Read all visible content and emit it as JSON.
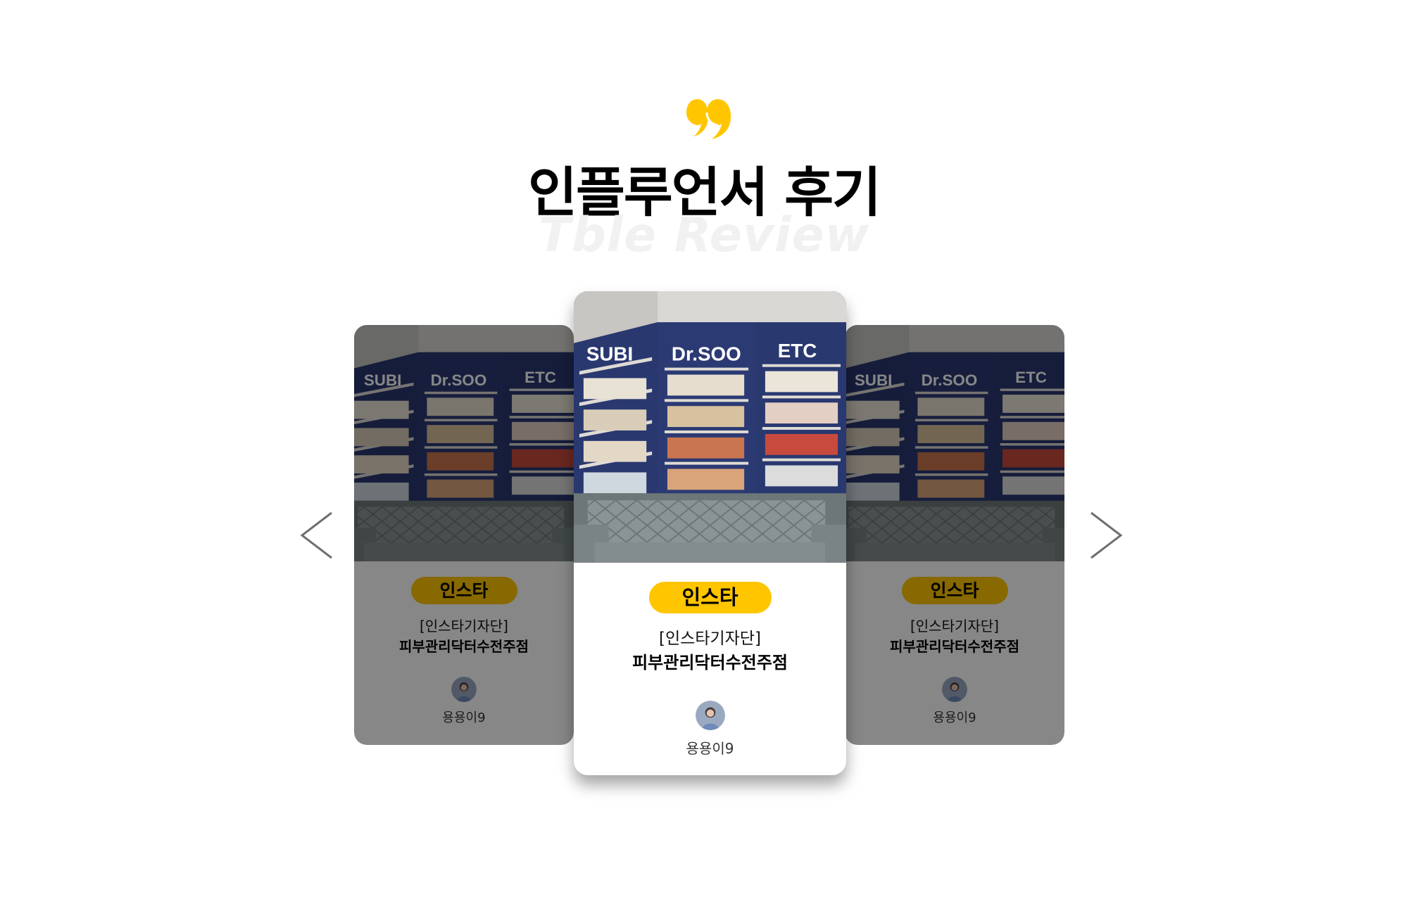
{
  "header": {
    "title": "인플루언서 후기",
    "subtitle": "Tble Review",
    "quote_icon": "quote-icon",
    "accent_color": "#ffc600"
  },
  "carousel": {
    "prev_icon": "chevron-left-icon",
    "next_icon": "chevron-right-icon",
    "cards": [
      {
        "position": "left",
        "state": "inactive",
        "badge": "인스타",
        "tag": "[인스타기자단]",
        "store": "피부관리닥터수전주점",
        "user": "용용이9",
        "photo_text": {
          "brand1": "SUBI",
          "brand2": "Dr.SOO",
          "brand3": "ETC"
        }
      },
      {
        "position": "center",
        "state": "active",
        "badge": "인스타",
        "tag": "[인스타기자단]",
        "store": "피부관리닥터수전주점",
        "user": "용용이9",
        "photo_text": {
          "brand1": "SUBI",
          "brand2": "Dr.SOO",
          "brand3": "ETC"
        }
      },
      {
        "position": "right",
        "state": "inactive",
        "badge": "인스타",
        "tag": "[인스타기자단]",
        "store": "피부관리닥터수전주점",
        "user": "용용이9",
        "photo_text": {
          "brand1": "SUBI",
          "brand2": "Dr.SOO",
          "brand3": "ETC"
        }
      }
    ]
  }
}
